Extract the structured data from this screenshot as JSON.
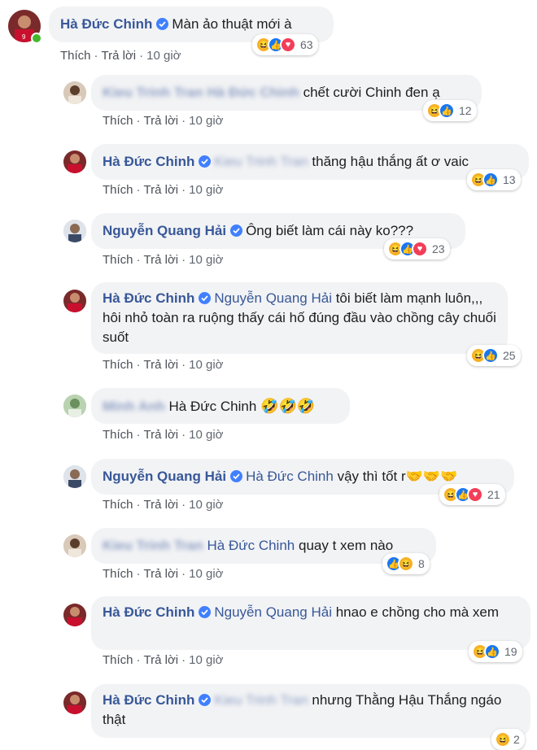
{
  "labels": {
    "like": "Thích",
    "reply": "Trả lời",
    "sep": "·"
  },
  "comments": [
    {
      "name": "Hà Đức Chinh",
      "verified": true,
      "tag": "",
      "text": "Màn ảo thuật mới à",
      "time": "10 giờ",
      "reactions": [
        "haha",
        "like",
        "love"
      ],
      "count": "63"
    },
    {
      "name": "Kieu Trinh Tran Hà Đức Chinh",
      "verified": false,
      "blurred": true,
      "tag": "",
      "text": "chết cười Chinh đen ạ",
      "time": "10 giờ",
      "reactions": [
        "haha",
        "like"
      ],
      "count": "12"
    },
    {
      "name": "Hà Đức Chinh",
      "verified": true,
      "tag": "Kieu Trinh Tran",
      "tag_blurred": true,
      "text": "thăng hậu thắng ất ơ vaic",
      "time": "10 giờ",
      "reactions": [
        "haha",
        "like"
      ],
      "count": "13"
    },
    {
      "name": "Nguyễn Quang Hải",
      "verified": true,
      "tag": "",
      "text": "Ông biết làm cái này ko???",
      "time": "10 giờ",
      "reactions": [
        "haha",
        "like",
        "love"
      ],
      "count": "23"
    },
    {
      "name": "Hà Đức Chinh",
      "verified": true,
      "tag": "Nguyễn Quang Hải",
      "text": "tôi biết làm mạnh luôn,,, hôi nhỏ toàn ra ruộng thấy cái hố đúng đầu vào chồng cây chuối suốt",
      "time": "10 giờ",
      "reactions": [
        "haha",
        "like"
      ],
      "count": "25"
    },
    {
      "name": "Minh Anh",
      "verified": false,
      "blurred": true,
      "tag": "Hà Đức Chinh",
      "text": "🤣🤣🤣",
      "time": "10 giờ",
      "reactions": [],
      "count": ""
    },
    {
      "name": "Nguyễn Quang Hải",
      "verified": true,
      "tag": "Hà Đức Chinh",
      "text": "vậy thì tốt r🤝🤝🤝",
      "time": "10 giờ",
      "reactions": [
        "haha",
        "like",
        "love"
      ],
      "count": "21"
    },
    {
      "name": "Kieu Trinh Tran",
      "verified": false,
      "blurred": true,
      "tag": "Hà Đức Chinh",
      "text": "quay t xem nào",
      "time": "10 giờ",
      "reactions": [
        "like",
        "haha"
      ],
      "count": "8"
    },
    {
      "name": "Hà Đức Chinh",
      "verified": true,
      "tag": "Nguyễn Quang Hải",
      "text": "hnao e chồng cho mà xem",
      "time": "10 giờ",
      "reactions": [
        "haha",
        "like"
      ],
      "count": "19"
    },
    {
      "name": "Hà Đức Chinh",
      "verified": true,
      "tag": "Kieu Trinh Tran",
      "tag_blurred": true,
      "text": "nhưng Thằng Hậu Thắng ngáo thật",
      "time": "",
      "reactions": [
        "haha"
      ],
      "count": "2"
    }
  ]
}
